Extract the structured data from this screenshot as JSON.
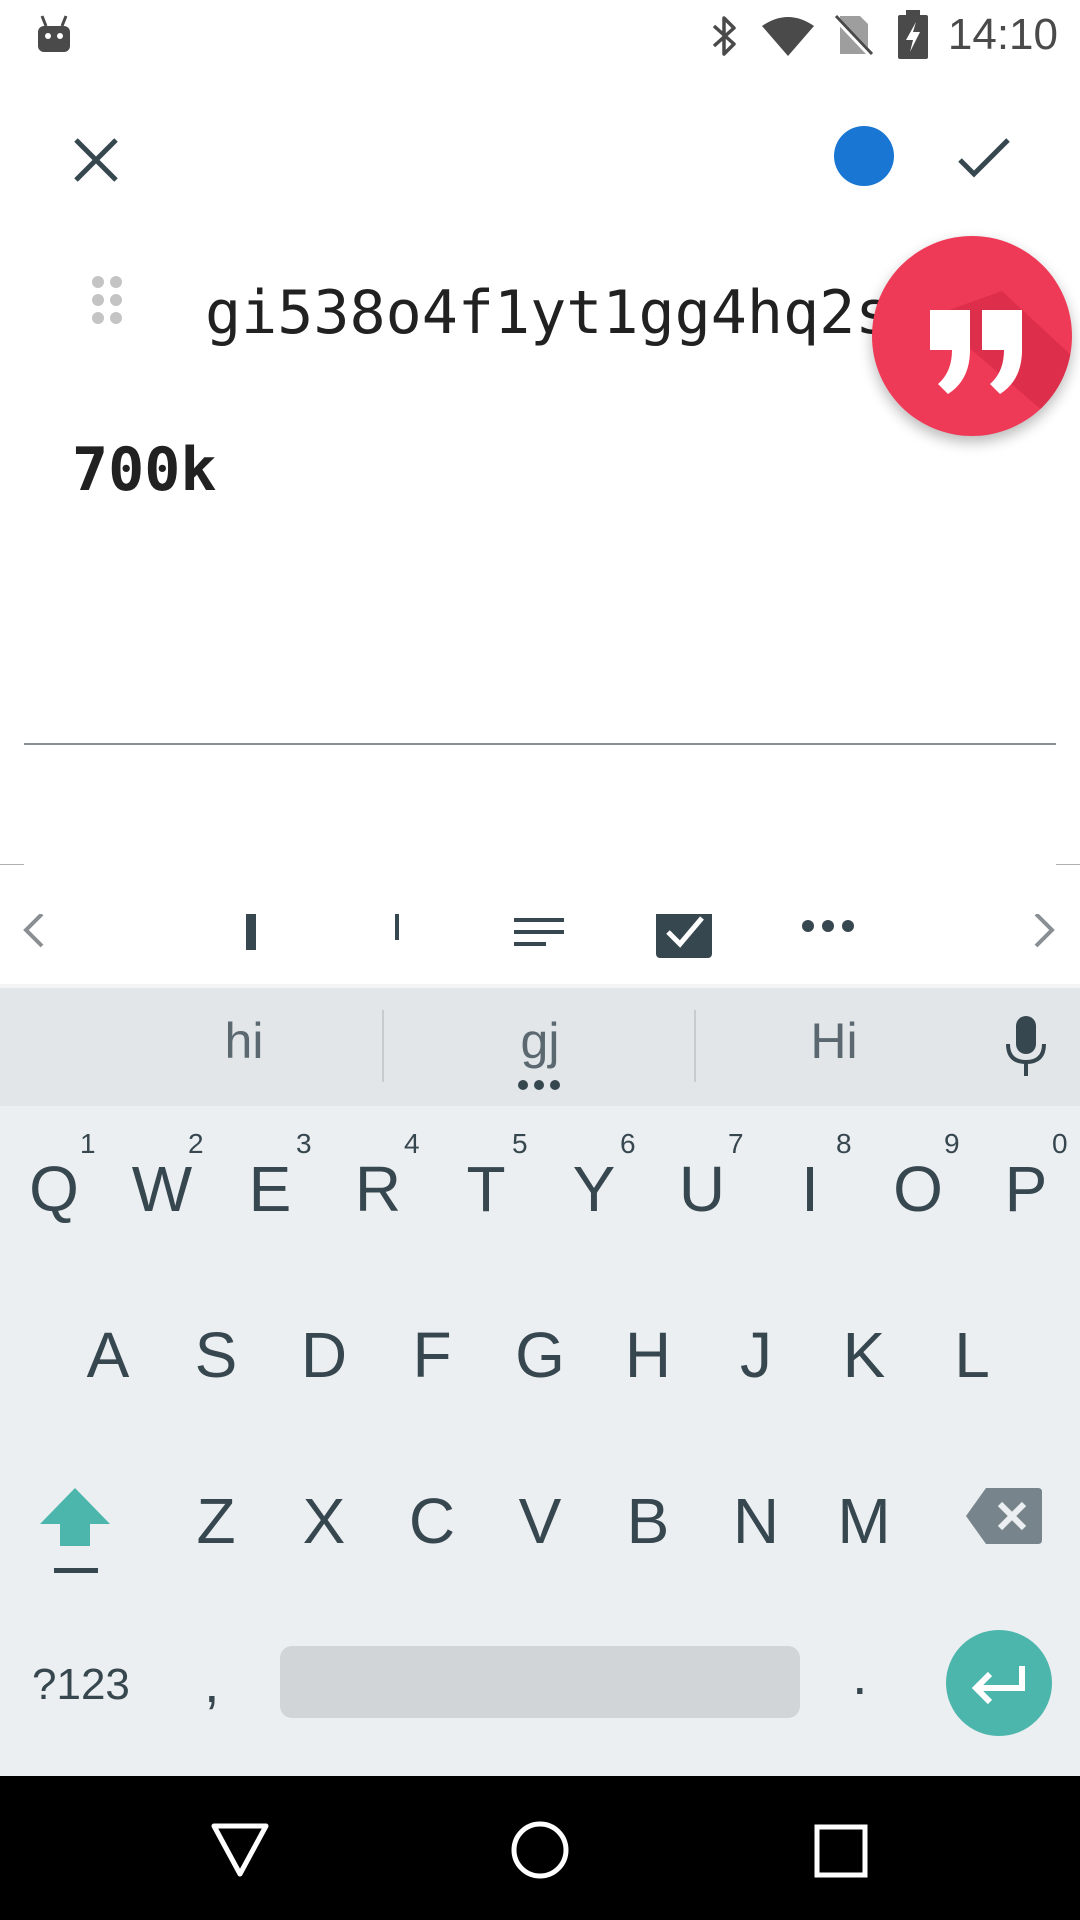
{
  "status_bar": {
    "time": "14:10",
    "icons": [
      "android-icon",
      "bluetooth-icon",
      "wifi-icon",
      "no-sim-icon",
      "battery-charging-icon"
    ]
  },
  "app_bar": {
    "close_icon": "close-icon",
    "color_icon": "color-circle-icon",
    "color": "#1976d2",
    "confirm_icon": "check-icon"
  },
  "editor": {
    "title": "gi538o4f1yt1gg4hq2s",
    "body": "700k",
    "fab_icon": "quote-icon",
    "fab_color": "#ef3a57"
  },
  "format_toolbar": {
    "items": [
      "chevron-left-icon",
      "bold-icon",
      "text-size-icon",
      "align-icon",
      "checkbox-icon",
      "more-icon",
      "chevron-right-icon"
    ]
  },
  "keyboard": {
    "suggestions": [
      "hi",
      "gj",
      "Hi"
    ],
    "row1": [
      {
        "key": "Q",
        "hint": "1"
      },
      {
        "key": "W",
        "hint": "2"
      },
      {
        "key": "E",
        "hint": "3"
      },
      {
        "key": "R",
        "hint": "4"
      },
      {
        "key": "T",
        "hint": "5"
      },
      {
        "key": "Y",
        "hint": "6"
      },
      {
        "key": "U",
        "hint": "7"
      },
      {
        "key": "I",
        "hint": "8"
      },
      {
        "key": "O",
        "hint": "9"
      },
      {
        "key": "P",
        "hint": "0"
      }
    ],
    "row2": [
      "A",
      "S",
      "D",
      "F",
      "G",
      "H",
      "J",
      "K",
      "L"
    ],
    "row3": [
      "Z",
      "X",
      "C",
      "V",
      "B",
      "N",
      "M"
    ],
    "symbols_key": "?123",
    "comma_key": ",",
    "period_key": ".",
    "shift_color": "#4db6ac",
    "enter_color": "#4db6ac"
  },
  "nav_bar": {
    "items": [
      "back-icon",
      "home-icon",
      "recents-icon"
    ]
  }
}
